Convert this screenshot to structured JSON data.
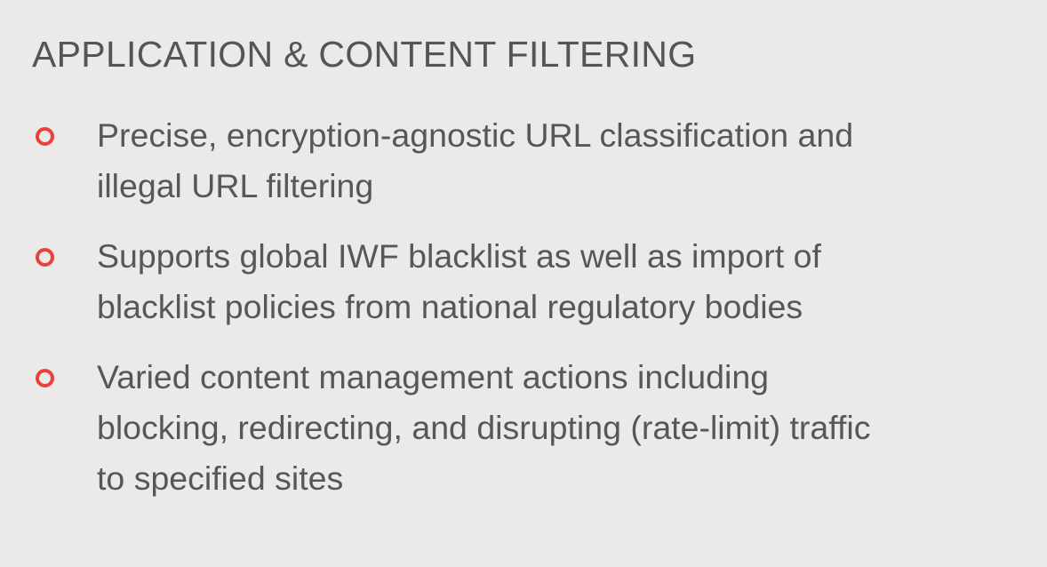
{
  "title": "APPLICATION & CONTENT FILTERING",
  "accent_color": "#e8423a",
  "bullets": [
    {
      "icon": "hollow-circle-bullet",
      "lines": [
        "Precise, encryption-agnostic URL classification and",
        "illegal URL filtering"
      ]
    },
    {
      "icon": "hollow-circle-bullet",
      "lines": [
        "Supports global IWF blacklist as well as import of",
        "blacklist policies from national regulatory bodies"
      ]
    },
    {
      "icon": "hollow-circle-bullet",
      "lines": [
        "Varied content management actions including",
        "blocking, redirecting, and disrupting (rate-limit) traffic",
        "to specified sites"
      ]
    }
  ]
}
